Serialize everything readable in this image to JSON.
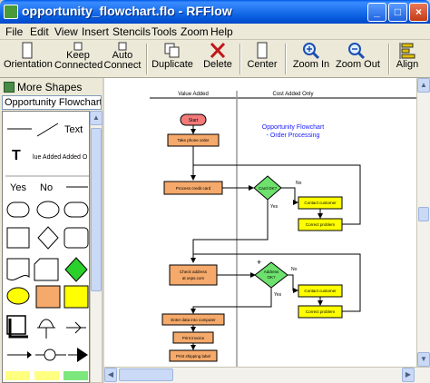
{
  "window": {
    "title": "opportunity_flowchart.flo - RFFlow"
  },
  "menu": [
    "File",
    "Edit",
    "View",
    "Insert",
    "Stencils",
    "Tools",
    "Zoom",
    "Help"
  ],
  "toolbar": {
    "orientation": "Orientation",
    "keep_connected_1": "Keep",
    "keep_connected_2": "Connected",
    "auto_connect_1": "Auto",
    "auto_connect_2": "Connect",
    "duplicate": "Duplicate",
    "delete": "Delete",
    "center": "Center",
    "zoom_in": "Zoom In",
    "zoom_out": "Zoom Out",
    "align": "Align"
  },
  "stencils": {
    "more_shapes": "More Shapes",
    "selected": "Opportunity Flowchart (Co",
    "text_sample": "Text",
    "value_added_label": "lue Added  Added O",
    "yes": "Yes",
    "no": "No"
  },
  "flowchart": {
    "col_value_added": "Value Added",
    "col_cost_added": "Cost Added Only",
    "title_1": "Opportunity Flowchart",
    "title_2": "- Order Processing",
    "start": "Start",
    "take_order": "Take phone order",
    "process_card": "Process credit card",
    "card_ok": "Card OK?",
    "no_1": "No",
    "yes_1": "Yes",
    "contact_customer_1": "Contact customer",
    "correct_problem_1": "Correct problem",
    "check_address_1": "Check address",
    "check_address_2": "at usps.com",
    "address_ok_1": "Address",
    "address_ok_2": "OK?",
    "no_2": "No",
    "yes_2": "Yes",
    "contact_customer_2": "Contact customer",
    "correct_problem_2": "Correct problem",
    "enter_data": "Enter data into computer",
    "print_invoice": "Print invoice",
    "print_label": "Print shipping label"
  },
  "colors": {
    "start_fill": "#f47a7a",
    "process_fill": "#f5a96a",
    "decision_fill": "#6de06d",
    "cost_fill": "#ffff00",
    "title_blue": "#1a1aff"
  }
}
